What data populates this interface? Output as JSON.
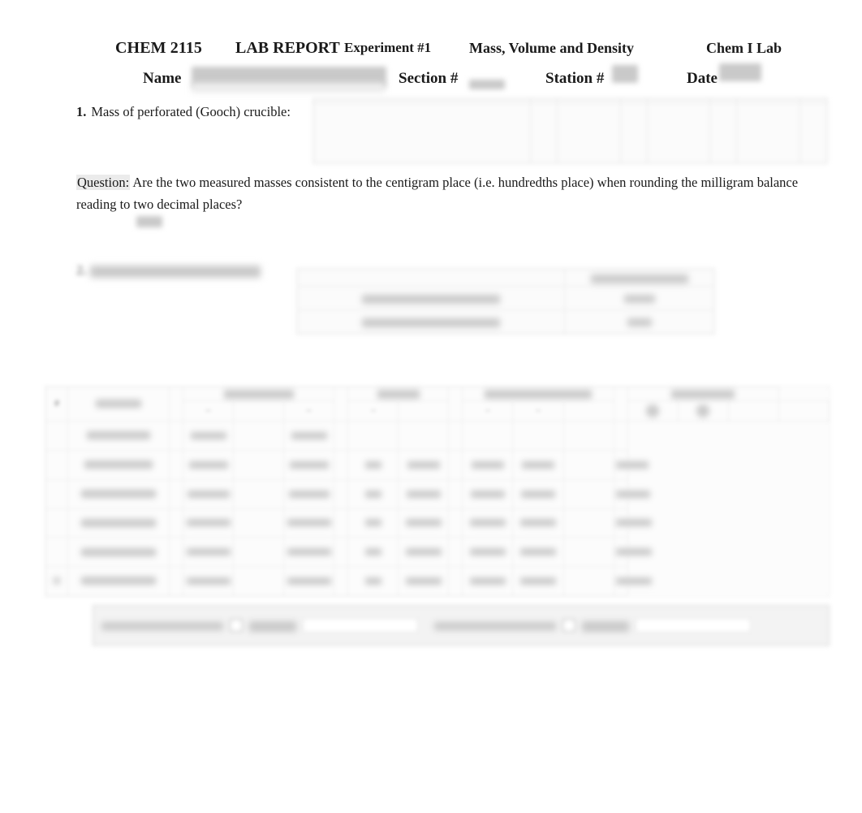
{
  "document": {
    "course_code": "CHEM 2115",
    "doc_type": "LAB REPORT",
    "experiment": "Experiment #1",
    "title": "Mass, Volume and Density",
    "course_name": "Chem I Lab",
    "fields": {
      "name_label": "Name",
      "name_value": "",
      "section_label": "Section #",
      "section_value": "",
      "station_label": "Station #",
      "station_value": "",
      "date_label": "Date",
      "date_value": ""
    }
  },
  "item1": {
    "number": "1.",
    "text": "Mass of perforated (Gooch) crucible:"
  },
  "table1": {
    "row_label": "",
    "headers": [
      "",
      "",
      "",
      ""
    ],
    "values": [
      "",
      "",
      ""
    ]
  },
  "question": {
    "label": "Question:",
    "text": "Are the two measured masses consistent to the centigram place (i.e. hundredths place) when rounding the milligram balance reading to two decimal places?",
    "answer": ""
  },
  "item2": {
    "number": "2.",
    "text": ""
  },
  "table2": {
    "header_col2": "",
    "rows": [
      {
        "label": "",
        "value": ""
      },
      {
        "label": "",
        "value": ""
      }
    ]
  },
  "chart_data": {
    "type": "table",
    "title": "",
    "group_headers": [
      "",
      "",
      "",
      "",
      "",
      "",
      ""
    ],
    "columns": [
      "#",
      "",
      "",
      "",
      "",
      "",
      "",
      "",
      "",
      "",
      "",
      "",
      "",
      "",
      ""
    ],
    "sub_headers": [
      "",
      "",
      "",
      "",
      "",
      "",
      "",
      ""
    ],
    "rows": [
      {
        "num": "",
        "cells": [
          "",
          "",
          "",
          "",
          "",
          "",
          "",
          "",
          "",
          "",
          "",
          "",
          "",
          ""
        ]
      },
      {
        "num": "",
        "cells": [
          "",
          "",
          "",
          "",
          "",
          "",
          "",
          "",
          "",
          "",
          "",
          "",
          "",
          ""
        ]
      },
      {
        "num": "",
        "cells": [
          "",
          "",
          "",
          "",
          "",
          "",
          "",
          "",
          "",
          "",
          "",
          "",
          "",
          ""
        ]
      },
      {
        "num": "",
        "cells": [
          "",
          "",
          "",
          "",
          "",
          "",
          "",
          "",
          "",
          "",
          "",
          "",
          "",
          ""
        ]
      },
      {
        "num": "",
        "cells": [
          "",
          "",
          "",
          "",
          "",
          "",
          "",
          "",
          "",
          "",
          "",
          "",
          "",
          ""
        ]
      },
      {
        "num": "",
        "cells": [
          "",
          "",
          "",
          "",
          "",
          "",
          "",
          "",
          "",
          "",
          "",
          "",
          "",
          ""
        ]
      }
    ]
  },
  "footer": {
    "group1": {
      "text_a": "",
      "text_b": "",
      "field": ""
    },
    "group2": {
      "text_a": "",
      "text_b": "",
      "field": ""
    }
  },
  "colors": {
    "page_background": "#ffffff",
    "text": "#1a1a1a",
    "redaction": "#c9c9c9",
    "table_border": "#ececec",
    "table_background": "#fbfbfb",
    "footer_background": "#f3f3f3"
  }
}
